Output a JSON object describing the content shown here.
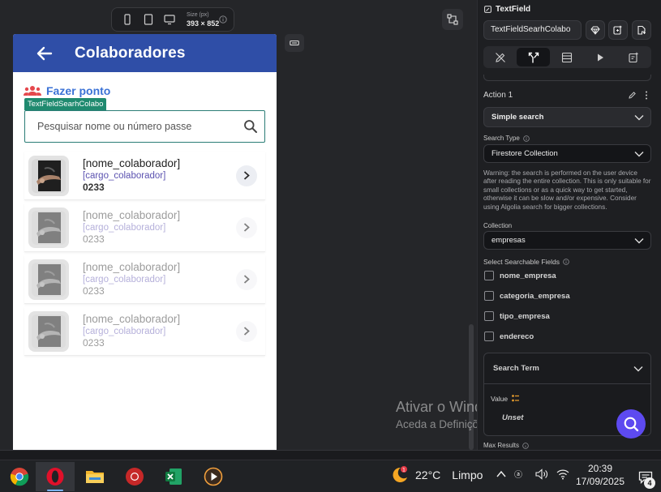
{
  "canvas": {
    "size_label": "Size (px)",
    "size_value": "393 × 852"
  },
  "app": {
    "title": "Colaboradores",
    "action_link": "Fazer ponto",
    "field_tag": "TextFieldSearhColabo",
    "search_placeholder": "Pesquisar nome ou número passe",
    "employees": [
      {
        "name": "[nome_colaborador]",
        "role": "[cargo_colaborador]",
        "code": "0233"
      },
      {
        "name": "[nome_colaborador]",
        "role": "[cargo_colaborador]",
        "code": "0233"
      },
      {
        "name": "[nome_colaborador]",
        "role": "[cargo_colaborador]",
        "code": "0233"
      },
      {
        "name": "[nome_colaborador]",
        "role": "[cargo_colaborador]",
        "code": "0233"
      }
    ]
  },
  "panel": {
    "widget_type": "TextField",
    "widget_name": "TextFieldSearhColabo",
    "tabs": [
      "edit-icon",
      "actions-icon",
      "layout-icon",
      "play-icon",
      "add-doc-icon"
    ],
    "action_label": "Action 1",
    "action_value": "Simple search",
    "search_type_label": "Search Type",
    "search_type_value": "Firestore Collection",
    "warning": "Warning: the search is performed on the user device after reading the entire collection. This is only suitable for small collections or as a quick way to get started, otherwise it can be slow and/or expensive. Consider using Algolia search for bigger collections.",
    "collection_label": "Collection",
    "collection_value": "empresas",
    "fields_label": "Select Searchable Fields",
    "fields": [
      "nome_empresa",
      "categoria_empresa",
      "tipo_empresa",
      "endereco"
    ],
    "search_term_label": "Search Term",
    "value_label": "Value",
    "value_state": "Unset",
    "max_results_label": "Max Results"
  },
  "watermark": {
    "title": "Ativar o Windows",
    "subtitle": "Aceda a Definições para ativar o Windows."
  },
  "taskbar": {
    "temperature": "22°C",
    "condition": "Limpo",
    "time": "20:39",
    "date": "17/09/2025",
    "notification_count": "4",
    "weather_badge": "1"
  },
  "colors": {
    "app_bar": "#2f4ea7",
    "link": "#3b72d6",
    "role_text": "#5b52b0",
    "field_tag": "#1f8a6f",
    "help_fab": "#5d4af0"
  }
}
